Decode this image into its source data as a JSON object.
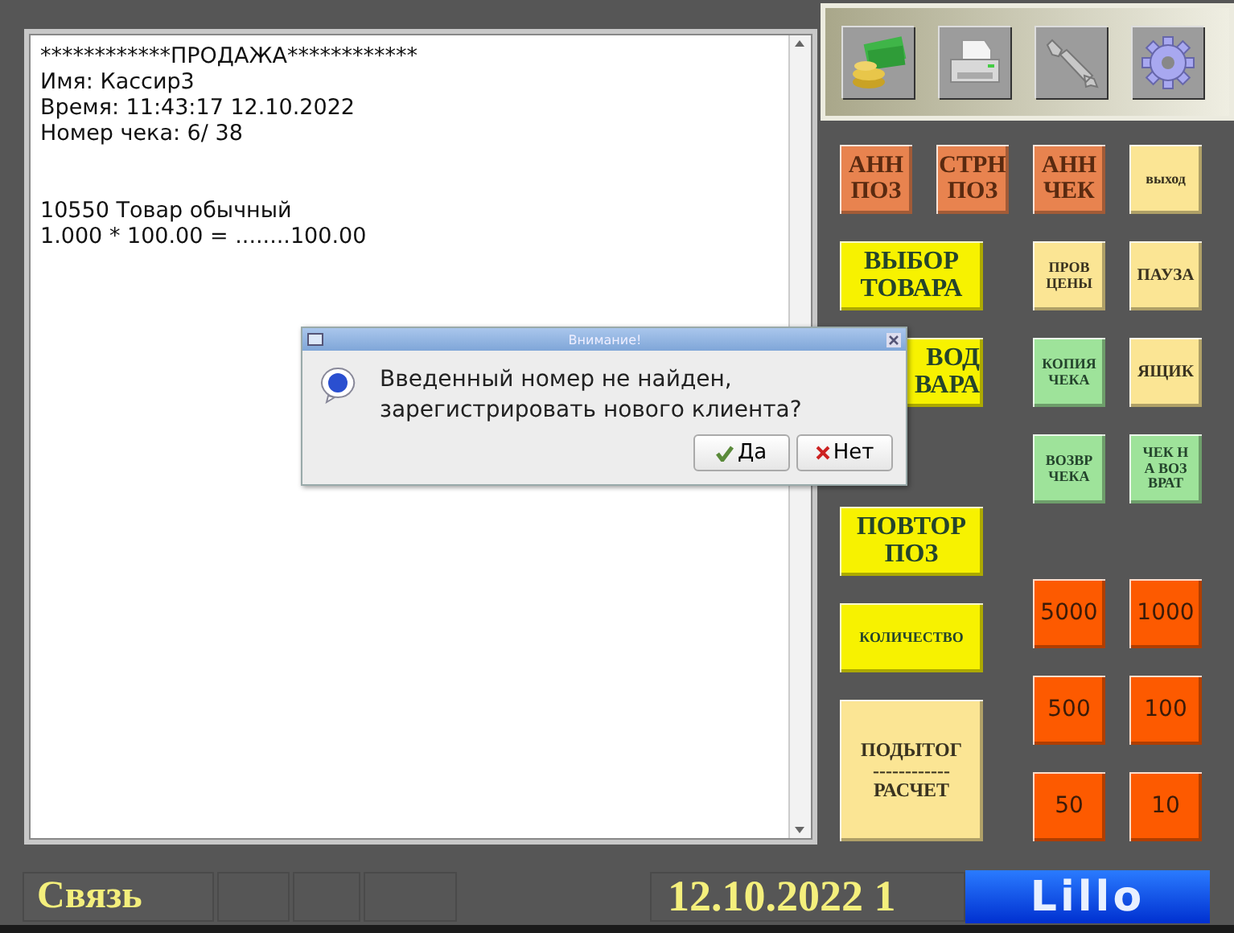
{
  "receipt": {
    "header": [
      "************ПРОДАЖА************",
      "Имя: Кассир3",
      "Время: 11:43:17 12.10.2022",
      "Номер чека: 6/ 38"
    ],
    "items": [
      "10550 Товар обычный",
      "1.000 * 100.00 = ........100.00"
    ]
  },
  "toolbar": [
    {
      "kind": "money"
    },
    {
      "kind": "printer"
    },
    {
      "kind": "wrench"
    },
    {
      "kind": "gear"
    }
  ],
  "keypad": {
    "top_row": [
      {
        "label": "АНН\nПОЗ",
        "kind": "cancel"
      },
      {
        "label": "СТРН\nПОЗ",
        "kind": "cancel"
      },
      {
        "label": "АНН\nЧЕК",
        "kind": "cancel"
      },
      {
        "label": "выход",
        "kind": "service"
      }
    ],
    "left_column": [
      {
        "label": "ВЫБОР\nТОВАРА",
        "kind": "main"
      },
      {
        "label": "ВОД\nВАРА",
        "kind": "main"
      },
      {
        "label": "ПОВТОР\nПОЗ",
        "kind": "main"
      },
      {
        "label": "КОЛИЧЕСТВО",
        "kind": "main"
      },
      {
        "label": "ПОДЫТОГ\n------------\nРАСЧЕТ",
        "kind": "total"
      }
    ],
    "right_grid": [
      {
        "label": "ПРОВ\nЦЕНЫ",
        "kind": "service"
      },
      {
        "label": "ПАУЗА",
        "kind": "service"
      },
      {
        "label": "КОПИЯ\nЧЕКА",
        "kind": "check"
      },
      {
        "label": "ЯЩИК",
        "kind": "service"
      },
      {
        "label": "ВОЗВР\nЧЕКА",
        "kind": "check"
      },
      {
        "label": "ЧЕК Н\nА ВОЗ\nВРАТ",
        "kind": "check"
      },
      {
        "label": "5000",
        "kind": "cash"
      },
      {
        "label": "1000",
        "kind": "cash"
      },
      {
        "label": "500",
        "kind": "cash"
      },
      {
        "label": "100",
        "kind": "cash"
      },
      {
        "label": "50",
        "kind": "cash"
      },
      {
        "label": "10",
        "kind": "cash"
      }
    ]
  },
  "dialog": {
    "title": "Внимание!",
    "message": "Введенный номер не найден,\nзарегистрировать нового клиента?",
    "buttons": [
      {
        "label": "Да",
        "kind": "yes"
      },
      {
        "label": "Нет",
        "kind": "no"
      }
    ]
  },
  "status_bar": {
    "connection": "Связь",
    "date": "12.10.2022 1",
    "logo": "Lillo"
  }
}
